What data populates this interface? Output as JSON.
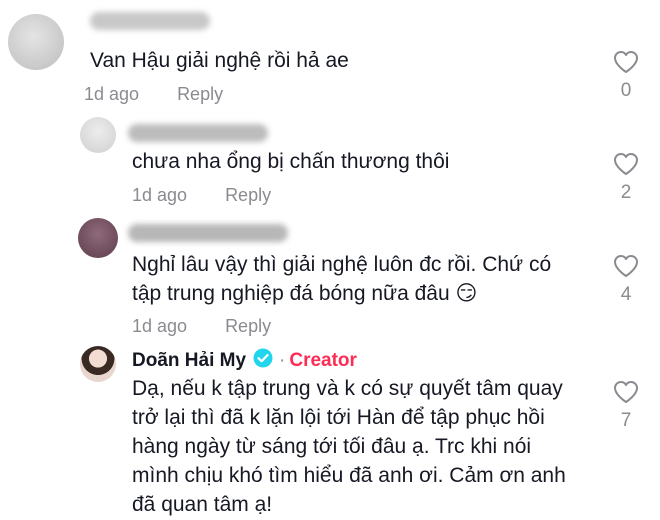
{
  "comments": [
    {
      "text_lines": [
        "Van Hậu giải nghệ rồi hả ae"
      ],
      "time": "1d ago",
      "reply_label": "Reply",
      "likes": "0"
    },
    {
      "text_lines": [
        "chưa nha ổng bị chấn thương thôi"
      ],
      "time": "1d ago",
      "reply_label": "Reply",
      "likes": "2"
    },
    {
      "text_lines": [
        "Nghỉ lâu vậy thì giải nghệ luôn đc rồi. Chứ có",
        "tập trung nghiệp đá bóng nữa đâu 😏"
      ],
      "time": "1d ago",
      "reply_label": "Reply",
      "likes": "4"
    },
    {
      "author": "Doãn Hải My",
      "badge": "Creator",
      "text_lines": [
        "Dạ, nếu k tập trung và k có sự quyết tâm quay",
        "trở lại thì đã k lặn lội tới Hàn để tập phục hồi",
        "hàng ngày từ sáng tới tối đâu ạ. Trc khi nói",
        "mình chịu khó tìm hiểu đã anh ơi. Cảm ơn anh",
        "đã quan tâm ạ!"
      ],
      "likes": "7"
    }
  ],
  "icons": {
    "like": "heart-outline-icon",
    "verified": "verified-check-icon"
  },
  "colors": {
    "creator": "#fe2c55",
    "verified": "#20d5ec",
    "meta": "#8a8b91"
  }
}
